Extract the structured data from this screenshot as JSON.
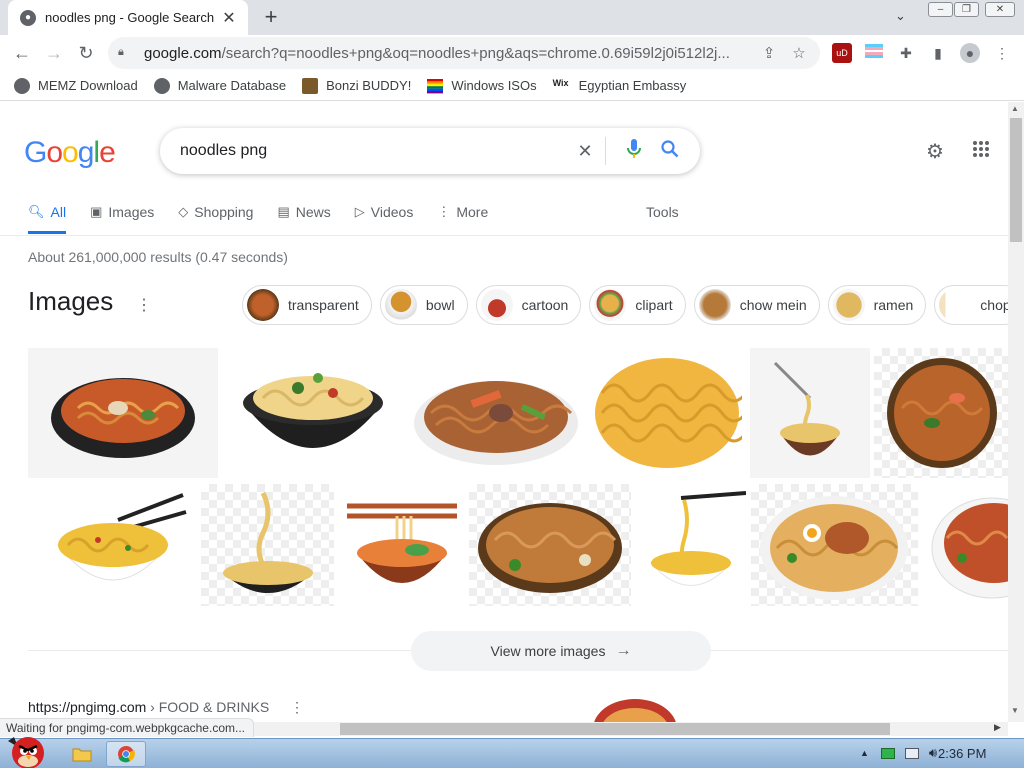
{
  "browser": {
    "tab_title": "noodles png - Google Search",
    "new_tab_symbol": "+",
    "url_host": "google.com",
    "url_rest": "/search?q=noodles+png&oq=noodles+png&aqs=chrome.0.69i59l2j0i512l2j...",
    "status_text": "Waiting for pngimg-com.webpkgcache.com..."
  },
  "bookmarks": [
    {
      "label": "MEMZ Download",
      "icon": "globe-icon"
    },
    {
      "label": "Malware Database",
      "icon": "globe-icon"
    },
    {
      "label": "Bonzi BUDDY!",
      "icon": "bonzi-icon"
    },
    {
      "label": "Windows ISOs",
      "icon": "rainbow-flag-icon"
    },
    {
      "label": "Egyptian Embassy",
      "icon": "wix-icon"
    }
  ],
  "search": {
    "logo_letters": [
      "G",
      "o",
      "o",
      "g",
      "l",
      "e"
    ],
    "logo_colors": [
      "#4285f4",
      "#ea4335",
      "#fbbc05",
      "#4285f4",
      "#34a853",
      "#ea4335"
    ],
    "query": "noodles png",
    "clear_symbol": "✕"
  },
  "nav_tabs": [
    {
      "label": "All",
      "icon": "search-icon",
      "active": true
    },
    {
      "label": "Images",
      "icon": "image-icon"
    },
    {
      "label": "Shopping",
      "icon": "tag-icon"
    },
    {
      "label": "News",
      "icon": "news-icon"
    },
    {
      "label": "Videos",
      "icon": "video-icon"
    },
    {
      "label": "More",
      "icon": "more-vert-icon"
    }
  ],
  "tools_label": "Tools",
  "result_stats": "About 261,000,000 results (0.47 seconds)",
  "images_section": {
    "header": "Images",
    "chips": [
      "transparent",
      "bowl",
      "cartoon",
      "clipart",
      "chow mein",
      "ramen",
      "chop"
    ],
    "view_more": "View more images"
  },
  "result": {
    "cite_url": "https://pngimg.com",
    "cite_path": " › FOOD & DRINKS"
  },
  "taskbar": {
    "clock": "2:36 PM"
  },
  "colors": {
    "accent": "#1a73e8",
    "mic_blue": "#4285f4",
    "noodle": "#e8b04a",
    "bowl_dark": "#2b2b2b"
  }
}
